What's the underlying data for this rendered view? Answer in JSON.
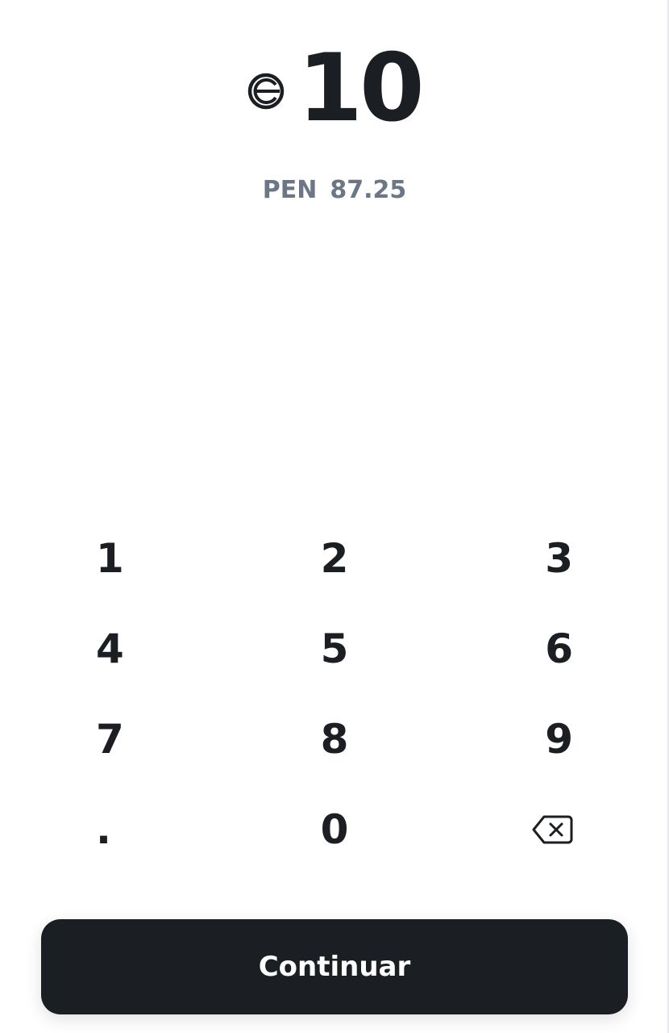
{
  "amount": {
    "token_icon": "worldcoin-icon",
    "value": "10"
  },
  "fiat": {
    "currency": "PEN",
    "value": "87.25"
  },
  "keypad": {
    "keys": [
      "1",
      "2",
      "3",
      "4",
      "5",
      "6",
      "7",
      "8",
      "9",
      ".",
      "0"
    ],
    "backspace_icon": "backspace-icon"
  },
  "continue_label": "Continuar",
  "colors": {
    "text": "#1b1e23",
    "muted": "#6b7686",
    "button_bg": "#1b1e23",
    "button_text": "#ffffff"
  }
}
